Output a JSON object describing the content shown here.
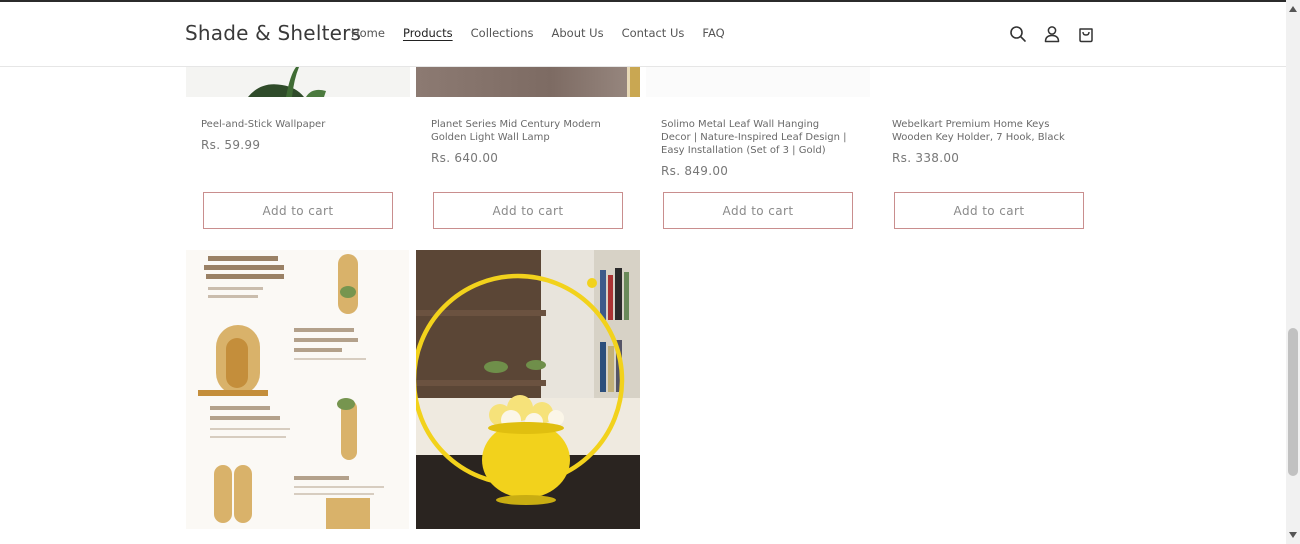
{
  "header": {
    "brand": "Shade & Shelters",
    "nav": [
      {
        "label": "Home"
      },
      {
        "label": "Products"
      },
      {
        "label": "Collections"
      },
      {
        "label": "About Us"
      },
      {
        "label": "Contact Us"
      },
      {
        "label": "FAQ"
      }
    ],
    "active_nav": "Products",
    "icons": [
      "search-icon",
      "account-icon",
      "cart-icon"
    ]
  },
  "products": [
    {
      "title": "Peel-and-Stick Wallpaper",
      "price": "Rs. 59.99",
      "button": "Add to cart"
    },
    {
      "title": "Planet Series Mid Century Modern Golden Light Wall Lamp",
      "price": "Rs. 640.00",
      "button": "Add to cart"
    },
    {
      "title": "Solimo Metal Leaf Wall Hanging Decor | Nature-Inspired Leaf Design | Easy Installation (Set of 3 | Gold)",
      "price": "Rs. 849.00",
      "button": "Add to cart"
    },
    {
      "title": "Webelkart Premium Home Keys Wooden Key Holder, 7 Hook, Black",
      "price": "Rs. 338.00",
      "button": "Add to cart"
    }
  ],
  "next_row_images": [
    "wooden-wall-test-tube-planter-image",
    "yellow-ring-flower-pot-image"
  ],
  "colors": {
    "accent_border": "#c98e8e",
    "ring_yellow": "#f2d21c"
  }
}
